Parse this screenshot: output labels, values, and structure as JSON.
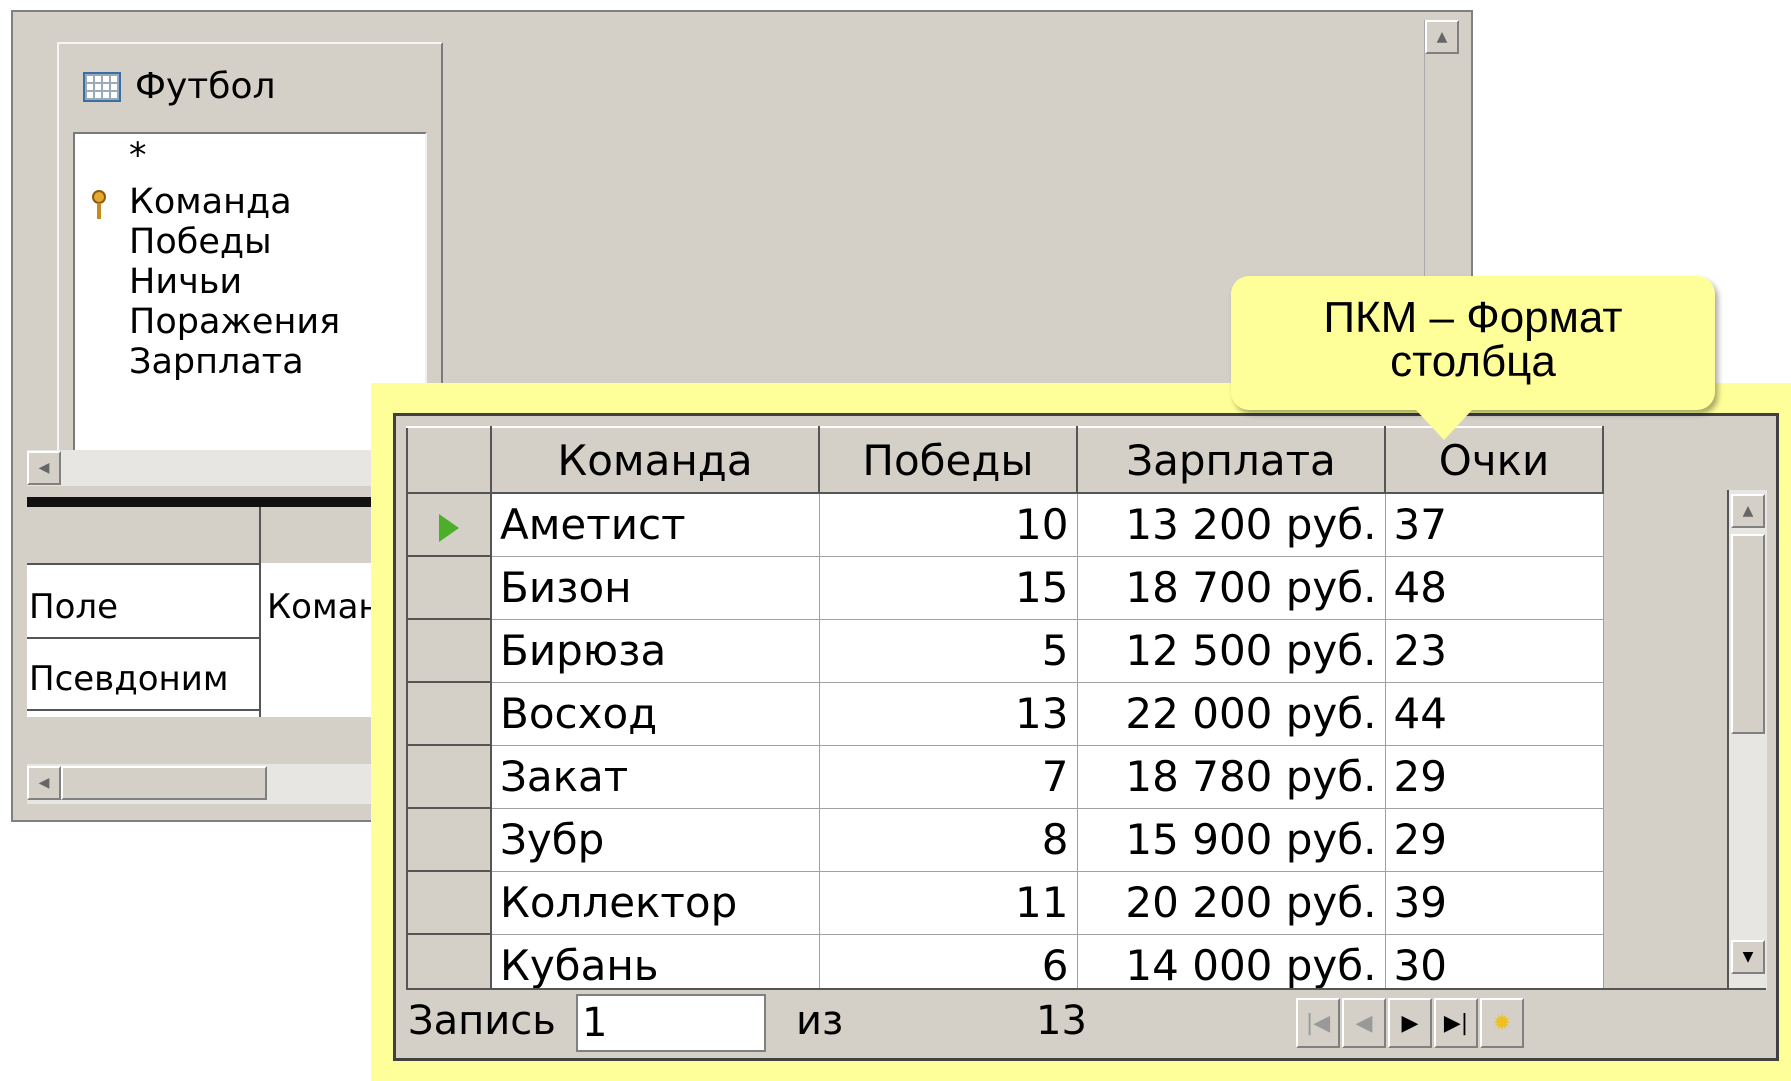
{
  "designer": {
    "table_title": "Футбол",
    "fields": [
      "*",
      "Команда",
      "Победы",
      "Ничьи",
      "Поражения",
      "Зарплата"
    ],
    "grid_rows": [
      {
        "label": "Поле",
        "value": "Коман"
      },
      {
        "label": "Псевдоним",
        "value": ""
      }
    ]
  },
  "sheet": {
    "columns": [
      "Команда",
      "Победы",
      "Зарплата",
      "Очки"
    ],
    "rows": [
      {
        "team": "Аметист",
        "wins": "10",
        "salary": "13 200 руб.",
        "points": "37"
      },
      {
        "team": "Бизон",
        "wins": "15",
        "salary": "18 700 руб.",
        "points": "48"
      },
      {
        "team": "Бирюза",
        "wins": "5",
        "salary": "12 500 руб.",
        "points": "23"
      },
      {
        "team": "Восход",
        "wins": "13",
        "salary": "22 000 руб.",
        "points": "44"
      },
      {
        "team": "Закат",
        "wins": "7",
        "salary": "18 780 руб.",
        "points": "29"
      },
      {
        "team": "Зубр",
        "wins": "8",
        "salary": "15 900 руб.",
        "points": "29"
      },
      {
        "team": "Коллектор",
        "wins": "11",
        "salary": "20 200 руб.",
        "points": "39"
      },
      {
        "team": "Кубань",
        "wins": "6",
        "salary": "14 000 руб.",
        "points": "30"
      }
    ],
    "nav": {
      "record_label": "Запись",
      "record_value": "1",
      "of_label": "из",
      "total": "13"
    }
  },
  "callout": {
    "line1": "ПКМ – Формат",
    "line2": "столбца"
  },
  "colors": {
    "highlight": "#ffff99",
    "window_bg": "#d4d0c8",
    "current_row_arrow": "#4caf2a"
  }
}
